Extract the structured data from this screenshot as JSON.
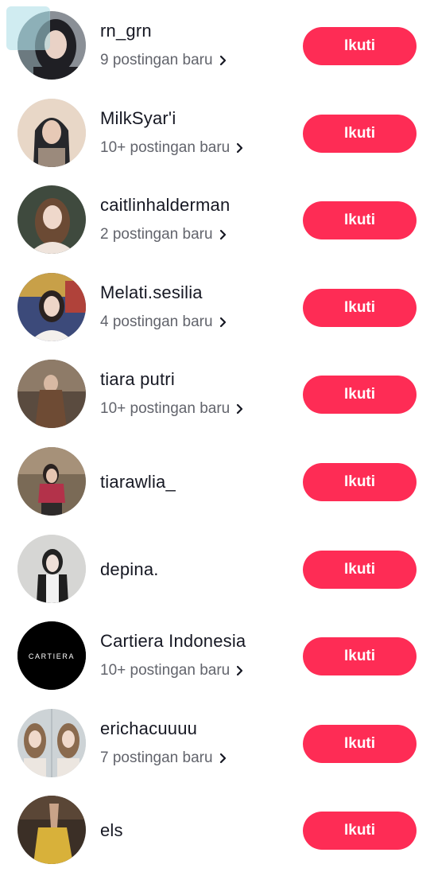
{
  "follow_label": "Ikuti",
  "accounts": [
    {
      "name": "rn_grn",
      "posts": "9 postingan baru",
      "avatar": {
        "bg": "#8a8f96",
        "fg": "#1f1f24",
        "skin": "#e9d2c6"
      }
    },
    {
      "name": "MilkSyar'i",
      "posts": "10+ postingan baru",
      "avatar": {
        "bg": "#e8d7c7",
        "fg": "#26272b",
        "skin": "#e7c9b6"
      }
    },
    {
      "name": "caitlinhalderman",
      "posts": "2 postingan baru",
      "avatar": {
        "bg": "#3f4a3e",
        "fg": "#6b4a34",
        "skin": "#efd8cb"
      }
    },
    {
      "name": "Melati.sesilia",
      "posts": "4 postingan baru",
      "avatar": {
        "bg": "#3c4a7a",
        "fg": "#2a2220",
        "skin": "#eed6c8"
      }
    },
    {
      "name": "tiara putri",
      "posts": "10+ postingan baru",
      "avatar": {
        "bg": "#5a4b3f",
        "fg": "#6e4b34",
        "skin": "#d8b9a3"
      }
    },
    {
      "name": "tiarawlia_",
      "posts": "",
      "avatar": {
        "bg": "#7a6a56",
        "fg": "#b3324a",
        "skin": "#e6c6b2"
      }
    },
    {
      "name": "depina.",
      "posts": "",
      "avatar": {
        "bg": "#d6d6d4",
        "fg": "#222222",
        "skin": "#efe0d8"
      }
    },
    {
      "name": "Cartiera Indonesia",
      "posts": "10+ postingan baru",
      "avatar": {
        "bg": "#000000",
        "logo_text": "CARTIERA"
      }
    },
    {
      "name": "erichacuuuu",
      "posts": "7 postingan baru",
      "avatar": {
        "bg": "#cdd3d6",
        "fg": "#8a6a4e",
        "skin": "#f0d9cb"
      }
    },
    {
      "name": "els",
      "posts": "",
      "avatar": {
        "bg": "#3b2f26",
        "fg": "#d8b13a",
        "skin": "#c9a388"
      }
    }
  ]
}
